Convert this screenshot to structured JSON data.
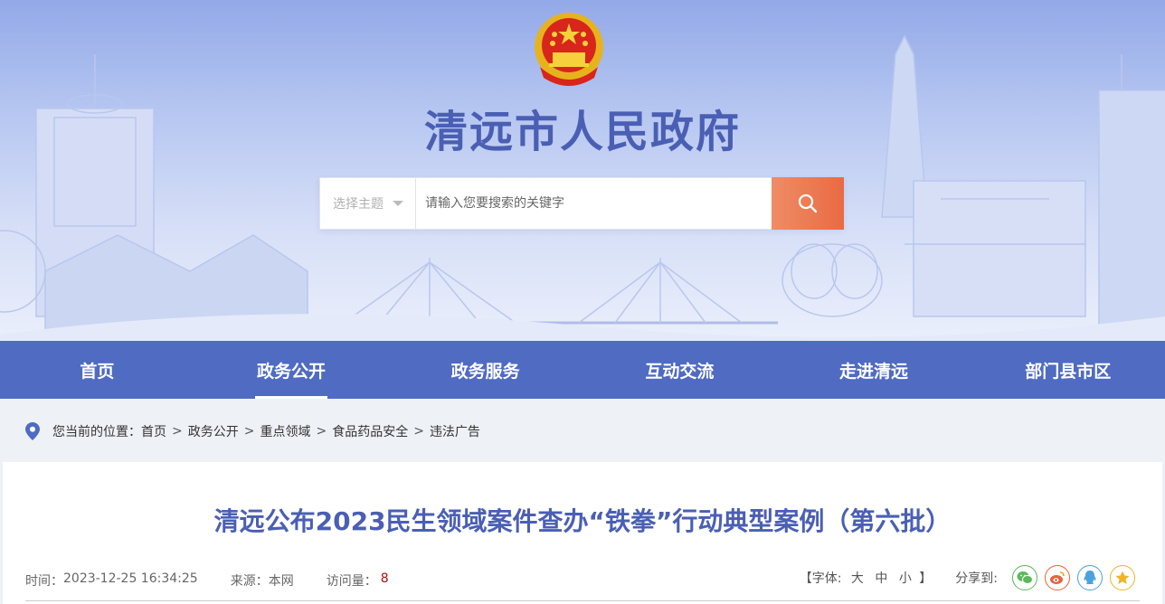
{
  "header": {
    "site_title": "清远市人民政府",
    "emblem_icon": "national-emblem-icon"
  },
  "search": {
    "topic_select_label": "选择主题",
    "placeholder": "请输入您要搜索的关键字",
    "button_icon": "search-icon"
  },
  "nav": {
    "items": [
      {
        "label": "首页",
        "active": false
      },
      {
        "label": "政务公开",
        "active": true
      },
      {
        "label": "政务服务",
        "active": false
      },
      {
        "label": "互动交流",
        "active": false
      },
      {
        "label": "走进清远",
        "active": false
      },
      {
        "label": "部门县市区",
        "active": false
      }
    ]
  },
  "breadcrumb": {
    "prefix": "您当前的位置：",
    "items": [
      "首页",
      "政务公开",
      "重点领域",
      "食品药品安全",
      "违法广告"
    ],
    "separator": ">"
  },
  "article": {
    "title": "清远公布2023民生领域案件查办“铁拳”行动典型案例（第六批）",
    "time_label": "时间：",
    "time_value": "2023-12-25 16:34:25",
    "source_label": "来源：",
    "source_value": "本网",
    "visits_label": "访问量：",
    "visits_value": "8"
  },
  "tools": {
    "font_open": "【字体:",
    "font_large": "大",
    "font_medium": "中",
    "font_small": "小",
    "font_close": "】",
    "share_label": "分享到:",
    "share_icons": [
      "wechat-icon",
      "weibo-icon",
      "qq-icon",
      "qzone-icon"
    ]
  },
  "colors": {
    "nav_bg": "#4f6bc2",
    "title_blue": "#4a5fb4",
    "search_button": "#ea6a43",
    "wechat": "#5cb85c",
    "weibo": "#e8633b",
    "qq": "#4aa3df",
    "qzone": "#f0b429"
  }
}
